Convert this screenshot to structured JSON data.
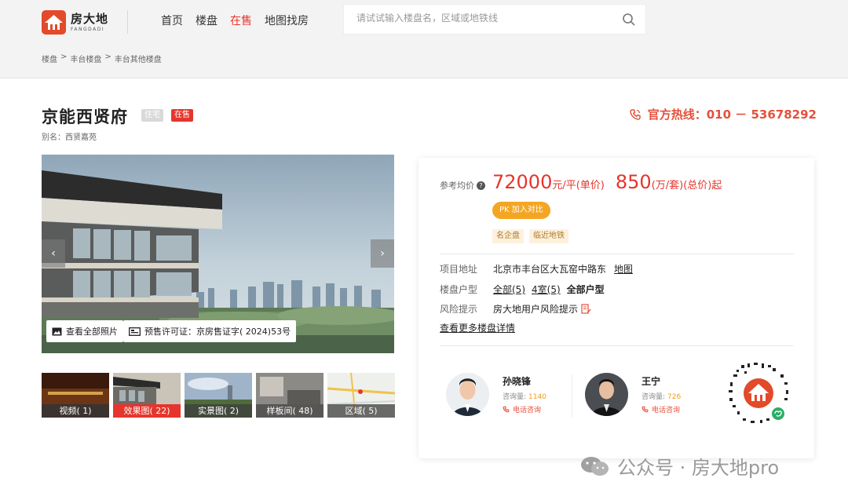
{
  "header": {
    "logo_cn": "房大地",
    "logo_en": "FANGDADI",
    "nav": [
      "首页",
      "楼盘",
      "在售",
      "地图找房"
    ],
    "active_nav": "在售",
    "search_placeholder": "请试试输入楼盘名，区域或地铁线"
  },
  "breadcrumb": [
    "楼盘",
    ">",
    "丰台楼盘",
    ">",
    "丰台其他楼盘"
  ],
  "project": {
    "name": "京能西贤府",
    "tag_type": "住宅",
    "tag_status": "在售",
    "alias": "别名：西贤嘉苑",
    "hotline": "官方热线：010 － 53678292"
  },
  "gallery": {
    "prev": "‹",
    "next": "›",
    "view_all": "查看全部照片",
    "permit": "预售许可证：京房售证字( 2024)53号",
    "thumbs": [
      {
        "label": "视频( 1)"
      },
      {
        "label": "效果图( 22)"
      },
      {
        "label": "实景图( 2)"
      },
      {
        "label": "样板间( 48)"
      },
      {
        "label": "区域( 5)"
      }
    ],
    "active_thumb": 1
  },
  "price": {
    "label": "参考均价",
    "q": "?",
    "unit_price": "72000",
    "unit_price_suffix": "元/平(单价)",
    "total_price": "850",
    "total_price_suffix": "(万/套)(总价)起",
    "pk_label": "PK  加入对比",
    "features": [
      "名企盘",
      "临近地铁"
    ]
  },
  "info": {
    "address_label": "项目地址",
    "address": "北京市丰台区大瓦窑中路东",
    "map_link": "地图",
    "layout_label": "楼盘户型",
    "layouts": [
      "全部(5)",
      "4室(5)"
    ],
    "layout_all": "全部户型",
    "risk_label": "风险提示",
    "risk": "房大地用户风险提示",
    "more": "查看更多楼盘详情"
  },
  "agents": [
    {
      "name": "孙晓锋",
      "count_label": "咨询量:",
      "count": "1140",
      "call": "电话咨询"
    },
    {
      "name": "王宁",
      "count_label": "咨询量:",
      "count": "726",
      "call": "电话咨询"
    }
  ],
  "watermark": "公众号 · 房大地pro",
  "colors": {
    "accent": "#e6352c",
    "hotline": "#e6503a",
    "pk": "#f4a623"
  }
}
